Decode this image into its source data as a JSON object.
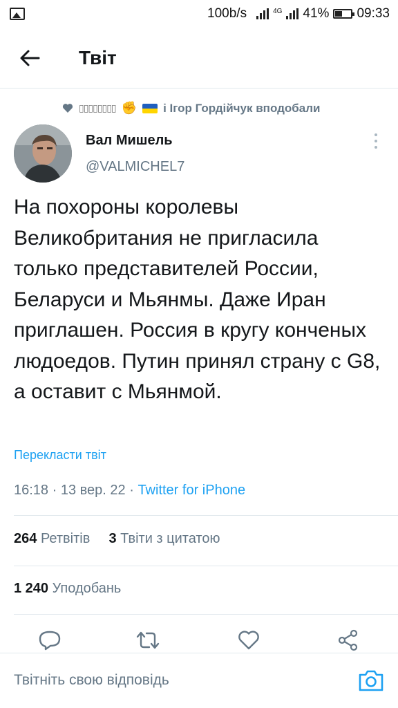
{
  "status_bar": {
    "speed": "100b/s",
    "network": "4G",
    "battery": "41%",
    "time": "09:33"
  },
  "header": {
    "title": "Твіт"
  },
  "liked_by": {
    "placeholder_name": "▯▯▯▯▯▯▯▯",
    "suffix": "і Ігор Гордійчук вподобали"
  },
  "author": {
    "name": "Вал Мишель",
    "handle": "@VALMICHEL7"
  },
  "tweet": {
    "text": "На похороны королевы Великобритания не пригласила только представителей России, Беларуси и Мьянмы. Даже Иран приглашен. Россия в кругу конченых людоедов. Путин принял страну с G8, а оставит с Мьянмой.",
    "translate_label": "Перекласти твіт",
    "time": "16:18",
    "date": "13 вер. 22",
    "source": "Twitter for iPhone"
  },
  "stats": {
    "retweets_count": "264",
    "retweets_label": "Ретвітів",
    "quotes_count": "3",
    "quotes_label": "Твіти з цитатою",
    "likes_count": "1 240",
    "likes_label": "Уподобань"
  },
  "reply": {
    "placeholder": "Твітніть свою відповідь"
  },
  "colors": {
    "accent": "#1da1f2",
    "secondary_text": "#657786",
    "divider": "#e1e8ed"
  }
}
